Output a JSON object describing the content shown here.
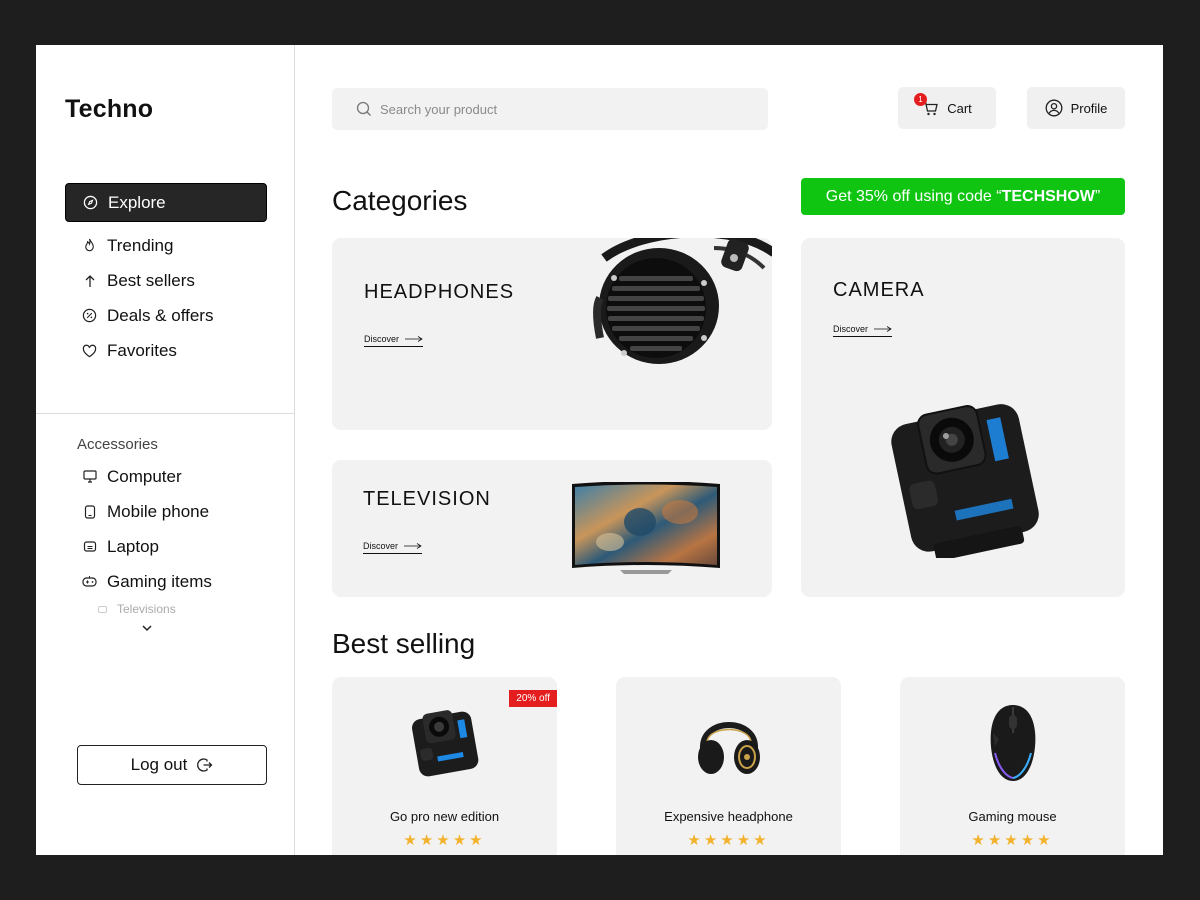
{
  "brand": "Techno",
  "nav": [
    {
      "label": "Explore",
      "icon": "compass-icon",
      "active": true
    },
    {
      "label": "Trending",
      "icon": "flame-icon"
    },
    {
      "label": "Best sellers",
      "icon": "arrow-up-icon"
    },
    {
      "label": "Deals & offers",
      "icon": "discount-badge-icon"
    },
    {
      "label": "Favorites",
      "icon": "heart-icon"
    }
  ],
  "accessories": {
    "heading": "Accessories",
    "items": [
      {
        "label": "Computer",
        "icon": "monitor-icon"
      },
      {
        "label": "Mobile phone",
        "icon": "phone-icon"
      },
      {
        "label": "Laptop",
        "icon": "laptop-icon"
      },
      {
        "label": "Gaming items",
        "icon": "gamepad-icon"
      }
    ],
    "more": "Televisions"
  },
  "logout_label": "Log out",
  "search": {
    "placeholder": "Search your product"
  },
  "cart": {
    "label": "Cart",
    "count": "1"
  },
  "profile": {
    "label": "Profile"
  },
  "categories": {
    "heading": "Categories",
    "promo_prefix": "Get 35% off using code “",
    "promo_code": "TECHSHOW",
    "promo_suffix": "”",
    "cards": [
      {
        "title": "HEADPHONES",
        "link": "Discover"
      },
      {
        "title": "TELEVISION",
        "link": "Discover"
      },
      {
        "title": "CAMERA",
        "link": "Discover"
      }
    ]
  },
  "best_selling": {
    "heading": "Best selling",
    "products": [
      {
        "name": "Go pro new edition",
        "badge": "20% off",
        "stars": "★★★★★",
        "rating": 5
      },
      {
        "name": "Expensive headphone",
        "stars": "★★★★★",
        "rating": 5
      },
      {
        "name": "Gaming mouse",
        "stars": "★★★★★",
        "rating": 5
      }
    ]
  },
  "colors": {
    "accent_green": "#0fc512",
    "badge_red": "#e41e1e",
    "star": "#f3b22e",
    "active_nav": "#262626"
  }
}
